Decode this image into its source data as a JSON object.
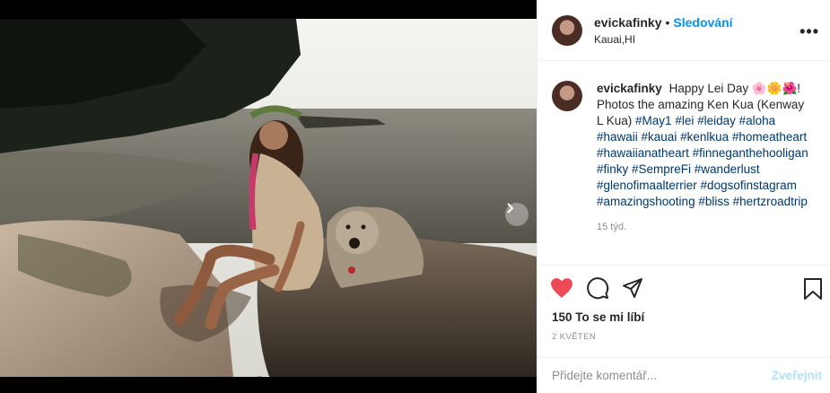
{
  "post": {
    "username": "evickafinky",
    "separator": "•",
    "follow_label": "Sledování",
    "location": "Kauai,HI",
    "more_label": "•••"
  },
  "caption": {
    "username": "evickafinky",
    "text": "Happy Lei Day 🌸🌼🌺! Photos the amazing Ken Kua (Kenway L Kua)",
    "hashtags": "#May1 #lei #leiday #aloha #hawaii #kauai #kenlkua #homeatheart #hawaiianatheart #finneganthehooligan #finky #SempreFi #wanderlust #glenofimaalterrier #dogsofinstagram #amazingshooting #bliss #hertzroadtrip",
    "time": "15 týd."
  },
  "stats": {
    "likes": "150 To se mi líbí",
    "date": "2 KVĚTEN"
  },
  "comment": {
    "placeholder": "Přidejte komentář...",
    "post_label": "Zveřejnit"
  },
  "icons": {
    "like": "heart-filled-icon",
    "comment": "comment-icon",
    "share": "share-icon",
    "save": "bookmark-icon",
    "next": "chevron-right-icon"
  },
  "colors": {
    "like": "#ed4956",
    "link": "#0095f6",
    "hashtag": "#00376b",
    "post_disabled": "#b2dffc"
  },
  "carousel": {
    "total": 2,
    "active": 1
  }
}
